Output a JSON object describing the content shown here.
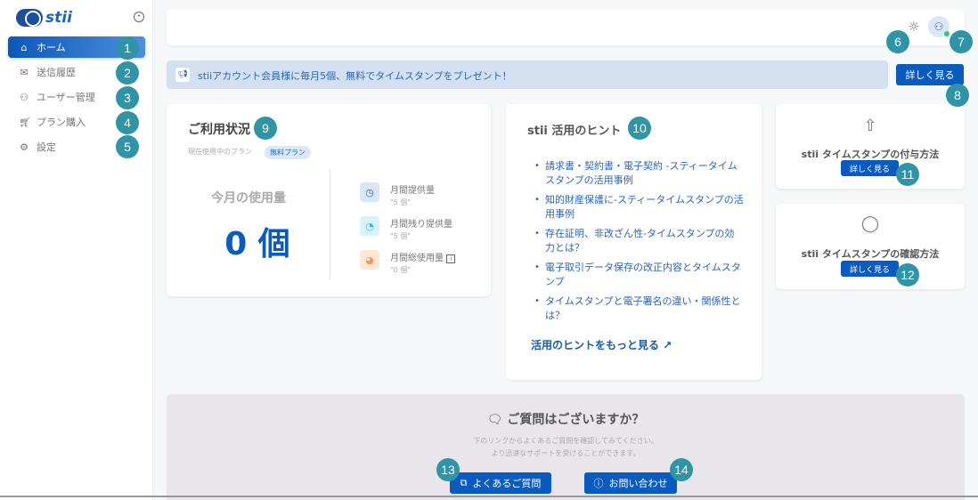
{
  "sidebar": {
    "logo": "stii",
    "items": [
      {
        "label": "ホーム",
        "icon": "home-icon"
      },
      {
        "label": "送信履歴",
        "icon": "mail-icon"
      },
      {
        "label": "ユーザー管理",
        "icon": "users-icon"
      },
      {
        "label": "プラン購入",
        "icon": "cart-icon"
      },
      {
        "label": "設定",
        "icon": "gear-icon"
      }
    ]
  },
  "banner": {
    "text": "stiiアカウント会員様に毎月5個、無料でタイムスタンプをプレゼント！",
    "button": "詳しく見る"
  },
  "usage": {
    "title": "ご利用状況",
    "plan_label": "現在使用中のプラン",
    "plan": "無料プラン",
    "month_label": "今月の使用量",
    "month_value": "0 個",
    "stats": [
      {
        "label": "月間提供量",
        "value": "\"5 個\""
      },
      {
        "label": "月間残り提供量",
        "value": "\"5 個\""
      },
      {
        "label": "月間総使用量",
        "value": "\"0 個\""
      }
    ]
  },
  "hints": {
    "title": "stii 活用のヒント",
    "items": [
      "請求書・契約書・電子契約 -スティータイムスタンプの活用事例",
      "知的財産保護に-スティータイムスタンプの活用事例",
      "存在証明、非改ざん性-タイムスタンプの効力とは？",
      "電子取引データ保存の改正内容とタイムスタンプ",
      "タイムスタンプと電子署名の違い・関係性とは？"
    ],
    "more": "活用のヒントをもっと見る"
  },
  "guides": [
    {
      "title": "stii タイムスタンプの付与方法",
      "button": "詳しく見る"
    },
    {
      "title": "stii タイムスタンプの確認方法",
      "button": "詳しく見る"
    }
  ],
  "faq": {
    "title": "ご質問はございますか？",
    "desc1": "下のリンクからよくあるご質問を確認してみてください。",
    "desc2": "より迅速なサポートを受けることができます。",
    "faq_button": "よくあるご質問",
    "contact_button": "お問い合わせ"
  },
  "badges": [
    "1",
    "2",
    "3",
    "4",
    "5",
    "6",
    "7",
    "8",
    "9",
    "10",
    "11",
    "12",
    "13",
    "14"
  ],
  "colors": {
    "primary": "#0a5bbf",
    "badge": "#2f95a6"
  }
}
